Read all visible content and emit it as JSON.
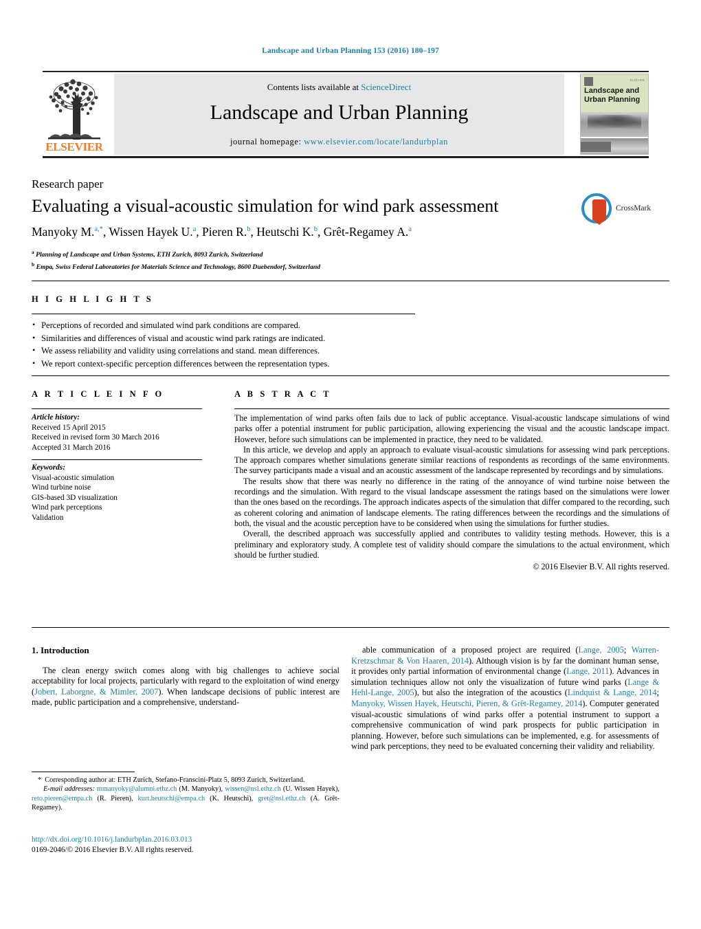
{
  "running_head": "Landscape and Urban Planning 153 (2016) 180–197",
  "masthead": {
    "contents_prefix": "Contents lists available at ",
    "contents_link": "ScienceDirect",
    "journal_title": "Landscape and Urban Planning",
    "homepage_label": "journal homepage:",
    "homepage_url": "www.elsevier.com/locate/landurbplan",
    "publisher_wordmark": "ELSEVIER",
    "cover_title_line1": "Landscape and",
    "cover_title_line2": "Urban Planning",
    "cover_mini_text": "ELSEVIER"
  },
  "article": {
    "type": "Research paper",
    "title": "Evaluating a visual-acoustic simulation for wind park assessment",
    "authors_html": "Manyoky M.<sup class=\"sup\">a,*</sup>, Wissen Hayek U.<sup class=\"sup\">a</sup>, Pieren R.<sup class=\"sup\">b</sup>, Heutschi K.<sup class=\"sup\">b</sup>, Grêt-Regamey A.<sup class=\"sup\">a</sup>",
    "affiliation_a": "Planning of Landscape and Urban Systems, ETH Zurich, 8093 Zurich, Switzerland",
    "affiliation_b": "Empa, Swiss Federal Laboratories for Materials Science and Technology, 8600 Duebendorf, Switzerland",
    "crossmark_label": "CrossMark"
  },
  "highlights": {
    "heading": "H I G H L I G H T S",
    "items": [
      "Perceptions of recorded and simulated wind park conditions are compared.",
      "Similarities and differences of visual and acoustic wind park ratings are indicated.",
      "We assess reliability and validity using correlations and stand. mean differences.",
      "We report context-specific perception differences between the representation types."
    ]
  },
  "article_info": {
    "heading": "A R T I C L E   I N F O",
    "history_label": "Article history:",
    "history": [
      "Received 15 April 2015",
      "Received in revised form 30 March 2016",
      "Accepted 31 March 2016"
    ],
    "keywords_label": "Keywords:",
    "keywords": [
      "Visual-acoustic simulation",
      "Wind turbine noise",
      "GIS-based 3D visualization",
      "Wind park perceptions",
      "Validation"
    ]
  },
  "abstract": {
    "heading": "A B S T R A C T",
    "paragraphs": [
      "The implementation of wind parks often fails due to lack of public acceptance. Visual-acoustic landscape simulations of wind parks offer a potential instrument for public participation, allowing experiencing the visual and the acoustic landscape impact. However, before such simulations can be implemented in practice, they need to be validated.",
      "In this article, we develop and apply an approach to evaluate visual-acoustic simulations for assessing wind park perceptions. The approach compares whether simulations generate similar reactions of respondents as recordings of the same environments. The survey participants made a visual and an acoustic assessment of the landscape represented by recordings and by simulations.",
      "The results show that there was nearly no difference in the rating of the annoyance of wind turbine noise between the recordings and the simulation. With regard to the visual landscape assessment the ratings based on the simulations were lower than the ones based on the recordings. The approach indicates aspects of the simulation that differ compared to the recording, such as coherent coloring and animation of landscape elements. The rating differences between the recordings and the simulations of both, the visual and the acoustic perception have to be considered when using the simulations for further studies.",
      "Overall, the described approach was successfully applied and contributes to validity testing methods. However, this is a preliminary and exploratory study. A complete test of validity should compare the simulations to the actual environment, which should be further studied."
    ],
    "rights": "© 2016 Elsevier B.V. All rights reserved."
  },
  "introduction": {
    "heading": "1. Introduction",
    "left_html": "The clean energy switch comes along with big challenges to achieve social acceptability for local projects, particularly with regard to the exploitation of wind energy (<span class=\"cite\">Jobert, Laborgne, &amp; Mimler, 2007</span>). When landscape decisions of public interest are made, public participation and a comprehensive, understand-",
    "right_html": "able communication of a proposed project are required (<span class=\"cite\">Lange, 2005</span>; <span class=\"cite\">Warren-Kretzschmar &amp; Von Haaren, 2014</span>). Although vision is by far the dominant human sense, it provides only partial information of environmental change (<span class=\"cite\">Lange, 2011</span>). Advances in simulation techniques allow not only the visualization of future wind parks (<span class=\"cite\">Lange &amp; Hehl-Lange, 2005</span>), but also the integration of the acoustics (<span class=\"cite\">Lindquist &amp; Lange, 2014</span>; <span class=\"cite\">Manyoky, Wissen Hayek, Heutschi, Pieren, &amp; Grêt-Regamey, 2014</span>). Computer generated visual-acoustic simulations of wind parks offer a potential instrument to support a comprehensive communication of wind park prospects for public participation in planning. However, before such simulations can be implemented, e.g. for assessments of wind park perceptions, they need to be evaluated concerning their validity and reliability."
  },
  "footnotes": {
    "corresponding_html": "<span class=\"mark\">*</span>&nbsp; Corresponding author at: ETH Zurich, Stefano-Franscini-Platz 5, 8093 Zurich, Switzerland.",
    "emails_label": "E-mail addresses:",
    "emails_html": "<span class=\"mail\">mmanyoky@alumni.ethz.ch</span> (M. Manyoky), <span class=\"mail\">wissen@nsl.ethz.ch</span> (U. Wissen Hayek), <span class=\"mail\">reto.pieren@empa.ch</span> (R. Pieren), <span class=\"mail\">kurt.heutschi@empa.ch</span> (K. Heutschi), <span class=\"mail\">gret@nsl.ethz.ch</span> (A. Grêt-Regamey)."
  },
  "doi": {
    "url": "http://dx.doi.org/10.1016/j.landurbplan.2016.03.013",
    "issn_line": "0169-2046/© 2016 Elsevier B.V. All rights reserved."
  },
  "colors": {
    "link_blue": "#1a7fa8",
    "elsevier_orange": "#f47b20",
    "masthead_gray": "#e6e7e8",
    "cover_green": "#d9e3c2",
    "crossmark_blue": "#2b8cc4",
    "crossmark_red": "#d9401f"
  }
}
